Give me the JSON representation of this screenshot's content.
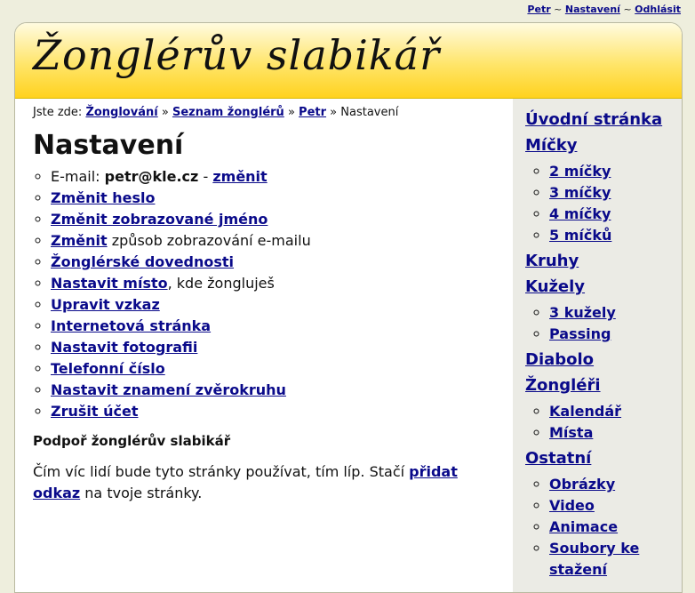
{
  "user_links": {
    "user": "Petr",
    "settings": "Nastavení",
    "logout": "Odhlásit",
    "separator": "~"
  },
  "header": {
    "logo_text": "Žonglérův slabikář"
  },
  "breadcrumb": {
    "prefix": "Jste zde:",
    "items": [
      "Žonglování",
      "Seznam žonglérů",
      "Petr"
    ],
    "separator": "»",
    "current": "Nastavení"
  },
  "page": {
    "title": "Nastavení",
    "email_label": "E-mail:",
    "email_value": "petr@kle.cz",
    "email_dash": "-",
    "email_change": "změnit",
    "items": [
      {
        "link": "Změnit heslo",
        "rest": ""
      },
      {
        "link": "Změnit zobrazované jméno",
        "rest": ""
      },
      {
        "link": "Změnit",
        "rest": " způsob zobrazování e-mailu"
      },
      {
        "link": "Žonglérské dovednosti",
        "rest": ""
      },
      {
        "link": "Nastavit místo",
        "rest": ", kde žongluješ"
      },
      {
        "link": "Upravit vzkaz",
        "rest": ""
      },
      {
        "link": "Internetová stránka",
        "rest": ""
      },
      {
        "link": "Nastavit fotografii",
        "rest": ""
      },
      {
        "link": "Telefonní číslo",
        "rest": ""
      },
      {
        "link": "Nastavit znamení zvěrokruhu",
        "rest": ""
      },
      {
        "link": "Zrušit účet",
        "rest": ""
      }
    ],
    "support_heading": "Podpoř žonglérův slabikář",
    "support_text_before": "Čím víc lidí bude tyto stránky používat, tím líp. Stačí ",
    "support_link": "přidat odkaz",
    "support_text_after": " na tvoje stránky."
  },
  "sidebar": {
    "sections": [
      {
        "label": "Úvodní stránka",
        "children": []
      },
      {
        "label": "Míčky",
        "children": [
          "2 míčky",
          "3 míčky",
          "4 míčky",
          "5 míčků"
        ]
      },
      {
        "label": "Kruhy",
        "children": []
      },
      {
        "label": "Kužely",
        "children": [
          "3 kužely",
          "Passing"
        ]
      },
      {
        "label": "Diabolo",
        "children": []
      },
      {
        "label": "Žongléři",
        "children": [
          "Kalendář",
          "Místa"
        ]
      },
      {
        "label": "Ostatní",
        "children": [
          "Obrázky",
          "Video",
          "Animace",
          "Soubory ke stažení"
        ]
      }
    ]
  }
}
